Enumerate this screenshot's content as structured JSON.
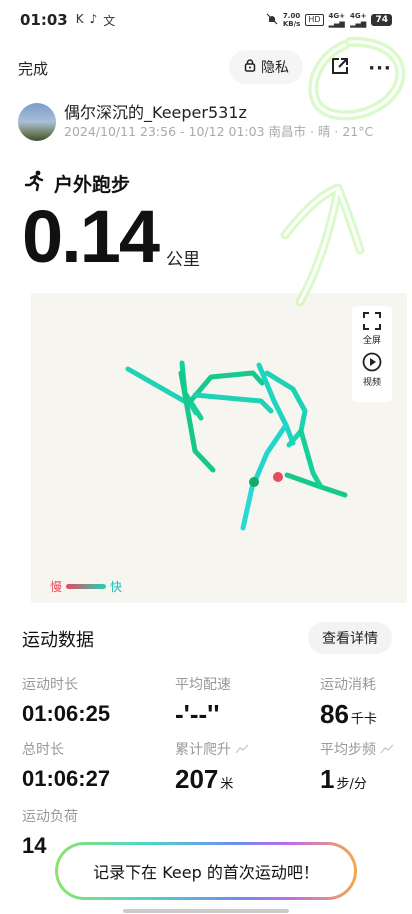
{
  "status_bar": {
    "time": "01:03",
    "left_icons": [
      "K",
      "♪",
      "文"
    ],
    "speed_value": "7.00",
    "speed_unit": "KB/s",
    "hd": "HD",
    "net1": "4G+",
    "net2": "4G+",
    "battery": "74"
  },
  "topbar": {
    "done_label": "完成",
    "privacy_label": "隐私",
    "share_icon": "share-icon",
    "more_label": "···"
  },
  "user": {
    "name": "偶尔深沉的_Keeper531z",
    "meta": "2024/10/11 23:56 - 10/12 01:03 南昌市 · 晴 · 21°C"
  },
  "activity": {
    "type_label": "户外跑步",
    "distance_value": "0.14",
    "distance_unit": "公里"
  },
  "map": {
    "fullscreen_label": "全屏",
    "video_label": "视频",
    "legend_slow": "慢",
    "legend_fast": "快",
    "colors": {
      "slow": "#e84a5f",
      "fast": "#1fd2b5",
      "mid": "#16c98a"
    }
  },
  "stats": {
    "title": "运动数据",
    "detail_button": "查看详情",
    "items": [
      {
        "label": "运动时长",
        "value": "01:06:25",
        "unit": ""
      },
      {
        "label": "平均配速",
        "value": "-'--''",
        "unit": ""
      },
      {
        "label": "运动消耗",
        "value": "86",
        "unit": "千卡"
      },
      {
        "label": "总时长",
        "value": "01:06:27",
        "unit": ""
      },
      {
        "label": "累计爬升",
        "value": "207",
        "unit": "米"
      },
      {
        "label": "平均步频",
        "value": "1",
        "unit": "步/分"
      },
      {
        "label": "运动负荷",
        "value": "14",
        "unit": ""
      }
    ]
  },
  "cta": {
    "label": "记录下在 Keep 的首次运动吧！"
  }
}
